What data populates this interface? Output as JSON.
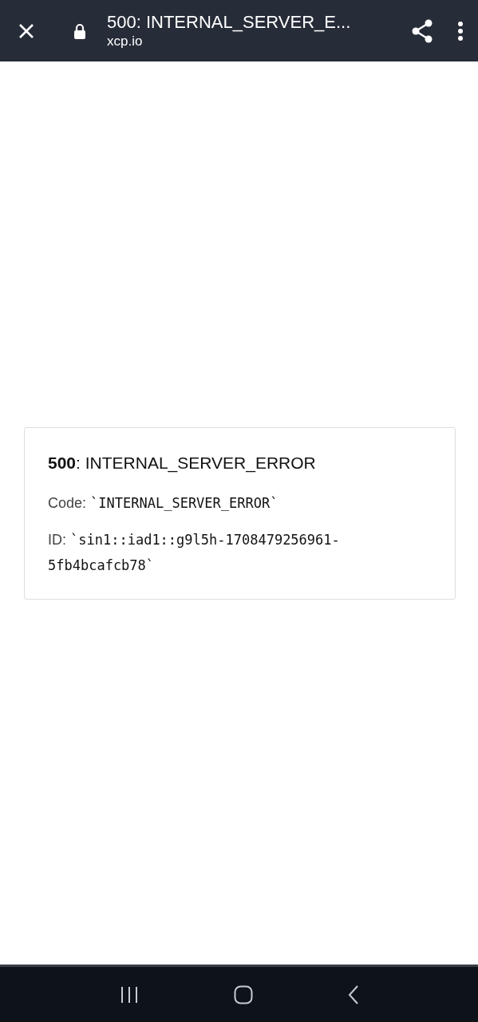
{
  "browser_bar": {
    "title": "500: INTERNAL_SERVER_E...",
    "url": "xcp.io"
  },
  "error_card": {
    "heading": "**500**: INTERNAL_SERVER_ERROR",
    "lines": [
      {
        "label": "Code:",
        "value": "`INTERNAL_SERVER_ERROR`"
      },
      {
        "label": "ID:",
        "value": "`sin1::iad1::g9l5h-1708479256961-5fb4bcafcb78`"
      }
    ]
  }
}
